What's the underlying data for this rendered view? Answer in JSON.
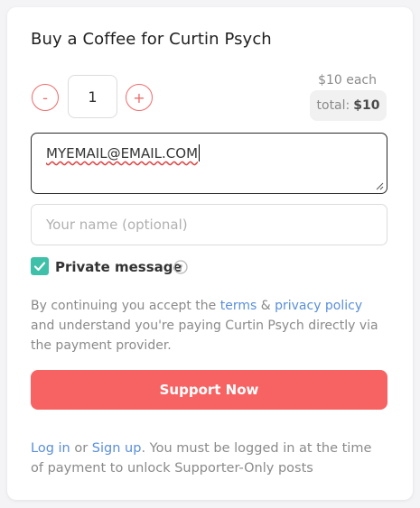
{
  "title": "Buy a Coffee for Curtin Psych",
  "quantity": {
    "minus_label": "-",
    "value": "1",
    "plus_label": "+"
  },
  "price": {
    "each": "$10 each",
    "total_label": "total:",
    "total_value": "$10"
  },
  "email": {
    "value": "MYEMAIL@EMAIL.COM"
  },
  "name_input": {
    "placeholder": "Your name (optional)"
  },
  "private": {
    "checked": true,
    "label": "Private message"
  },
  "consent": {
    "prefix": "By continuing you accept the ",
    "terms": "terms",
    "amp": " & ",
    "privacy": "privacy policy",
    "suffix": " and understand you're paying Curtin Psych directly via the payment provider."
  },
  "support_button": "Support Now",
  "footer": {
    "login": "Log in",
    "or": " or ",
    "signup": "Sign up",
    "rest": ". You must be logged in at the time of payment to unlock Supporter-Only posts"
  },
  "colors": {
    "accent": "#f76363",
    "checkbox": "#3fc0a8",
    "link": "#5a8fd8"
  }
}
